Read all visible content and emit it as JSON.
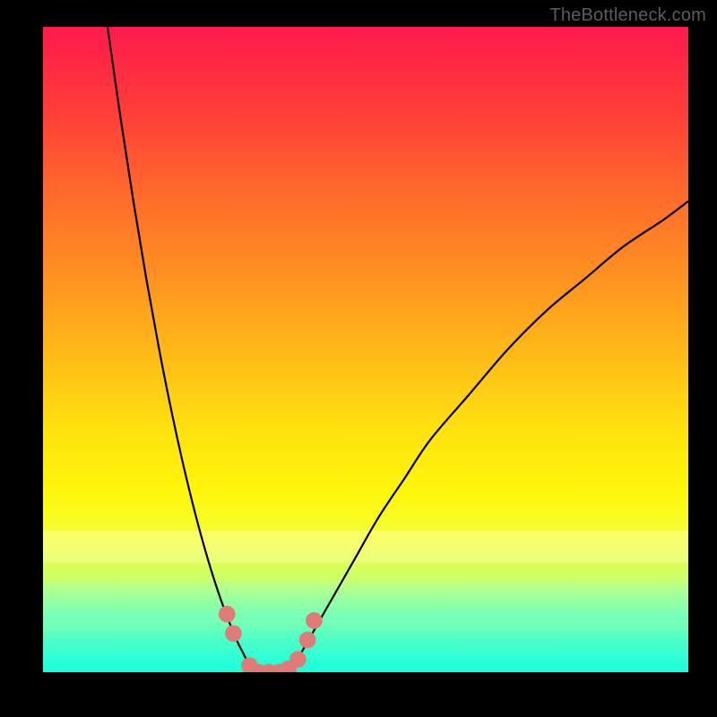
{
  "watermark": "TheBottleneck.com",
  "chart_data": {
    "type": "line",
    "title": "",
    "xlabel": "",
    "ylabel": "",
    "xlim": [
      0,
      100
    ],
    "ylim": [
      0,
      100
    ],
    "grid": false,
    "legend": false,
    "series": [
      {
        "name": "left-curve",
        "x": [
          10,
          12,
          14,
          16,
          18,
          20,
          22,
          24,
          26,
          28,
          30,
          31,
          32,
          33
        ],
        "y": [
          100,
          86,
          73,
          61,
          50,
          40,
          31,
          23,
          16,
          10,
          5,
          3,
          1,
          0
        ]
      },
      {
        "name": "right-curve",
        "x": [
          38,
          40,
          44,
          48,
          52,
          56,
          60,
          66,
          72,
          78,
          84,
          90,
          96,
          100
        ],
        "y": [
          0,
          3,
          10,
          17,
          24,
          30,
          36,
          43,
          50,
          56,
          61,
          66,
          70,
          73
        ]
      },
      {
        "name": "trough",
        "x": [
          33,
          34,
          35,
          36,
          37,
          38
        ],
        "y": [
          0,
          0,
          0,
          0,
          0,
          0
        ]
      }
    ],
    "markers": {
      "name": "highlighted-points",
      "color": "#e07c78",
      "points": [
        {
          "x": 28.5,
          "y": 9
        },
        {
          "x": 29.5,
          "y": 6
        },
        {
          "x": 32,
          "y": 1
        },
        {
          "x": 33.5,
          "y": 0
        },
        {
          "x": 35,
          "y": 0
        },
        {
          "x": 36.5,
          "y": 0
        },
        {
          "x": 38,
          "y": 0.5
        },
        {
          "x": 39.5,
          "y": 2
        },
        {
          "x": 41,
          "y": 5
        },
        {
          "x": 42,
          "y": 8
        }
      ]
    },
    "background_gradient": {
      "top_color": "#ff1a4d",
      "bottom_color": "#18ffdc",
      "description": "vertical red-to-teal gradient"
    }
  }
}
